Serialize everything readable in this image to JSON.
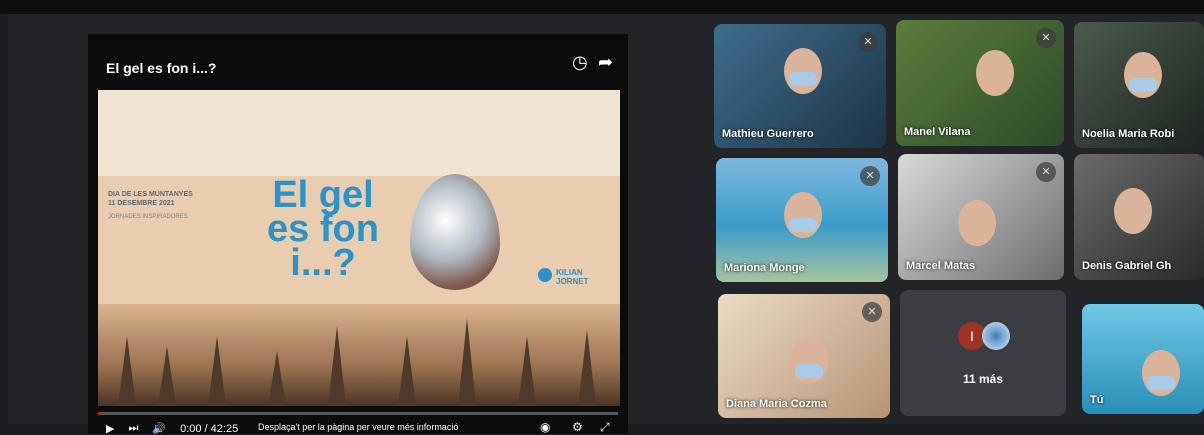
{
  "video": {
    "title": "El gel es fon i...?",
    "slide": {
      "side_text": "DIA DE LES MUNTANYES\n11 DESEMBRE 2021",
      "side_sub": "JORNADES INSPIRADORES",
      "headline": "El gel\nes fon\ni...?",
      "brand": "KILIAN\nJORNET"
    },
    "time": "0:00 / 42:25",
    "progress": 0.004,
    "hint": "Desplaça't per la pàgina per veure més informació"
  },
  "participants": [
    {
      "name": "Mathieu Guerrero"
    },
    {
      "name": "Manel Vilana"
    },
    {
      "name": "Noelia Maria Robi"
    },
    {
      "name": "Mariona Monge"
    },
    {
      "name": "Marcel Matas"
    },
    {
      "name": "Denis Gabriel Gh"
    },
    {
      "name": "Diana Maria Cozma"
    },
    {
      "name": "Tú"
    }
  ],
  "more": {
    "initial": "I",
    "label": "11 más"
  },
  "colors": {
    "accent": "#2a93c9",
    "progress": "#ff0000",
    "tile_bg": "#3b3d42"
  }
}
